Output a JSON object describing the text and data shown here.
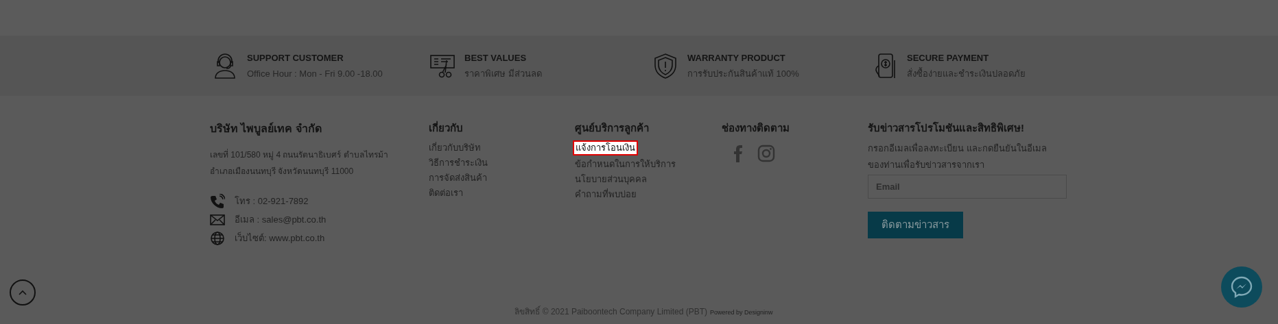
{
  "features": [
    {
      "kind": "headset",
      "title": "SUPPORT CUSTOMER",
      "text": "Office Hour : Mon - Fri 9.00 -18.00"
    },
    {
      "kind": "voucher",
      "title": "BEST VALUES",
      "text": "ราคาพิเศษ มีส่วนลด"
    },
    {
      "kind": "shield",
      "title": "WARRANTY PRODUCT",
      "text": "การรับประกันสินค้าแท้ 100%"
    },
    {
      "kind": "phone-pay",
      "title": "SECURE PAYMENT",
      "text": "สั่งซื้อง่ายและชำระเงินปลอดภัย"
    }
  ],
  "company": {
    "name": "บริษัท ไพบูลย์เทค จำกัด",
    "address": [
      "เลขที่ 101/580 หมู่ 4 ถนนรัตนาธิเบศร์ ตำบลไทรม้า",
      "อำเภอเมืองนนทบุรี จังหวัดนนทบุรี  11000"
    ],
    "contacts": [
      {
        "kind": "phone",
        "text": "โทร : 02-921-7892"
      },
      {
        "kind": "mail",
        "text": "อีเมล : sales@pbt.co.th"
      },
      {
        "kind": "web",
        "text": "เว็บไซต์: www.pbt.co.th"
      }
    ]
  },
  "about": {
    "title": "เกี่ยวกับ",
    "links": [
      "เกี่ยวกับบริษัท",
      "วิธีการชำระเงิน",
      "การจัดส่งสินค้า",
      "ติดต่อเรา"
    ]
  },
  "service": {
    "title": "ศูนย์บริการลูกค้า",
    "links": [
      {
        "label": "แจ้งการโอนเงิน",
        "selected": true
      },
      {
        "label": "ข้อกำหนดในการให้บริการ",
        "selected": false
      },
      {
        "label": "นโยบายส่วนบุคคล",
        "selected": false
      },
      {
        "label": "คำถามที่พบบ่อย",
        "selected": false
      }
    ]
  },
  "follow": {
    "title": "ช่องทางติดตาม",
    "socials": [
      {
        "kind": "facebook"
      },
      {
        "kind": "instagram"
      }
    ]
  },
  "newsletter": {
    "title": "รับข่าวสารโปรโมชันและสิทธิพิเศษ!",
    "text": "กรอกอีเมลเพื่อลงทะเบียน และกดยืนยันในอีเมลของท่านเพื่อรับข่าวสารจากเรา",
    "placeholder": "Email",
    "button": "ติดตามข่าวสาร"
  },
  "copyright": "ลิขสิทธิ์ © 2021 Paiboontech Company Limited (PBT)",
  "powered": "Powered by Designinw"
}
